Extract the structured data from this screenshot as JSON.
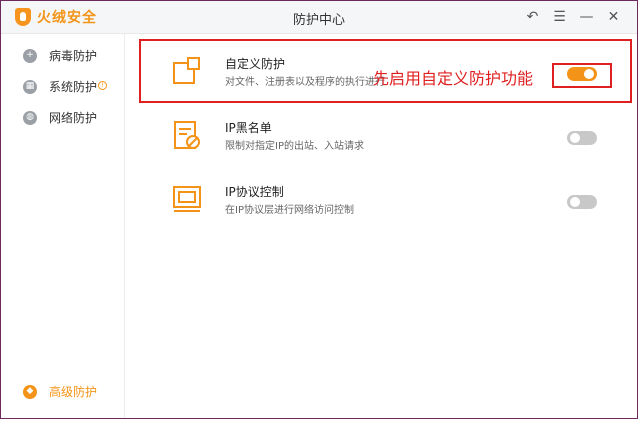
{
  "app": {
    "logo_text": "火绒安全",
    "window_title": "防护中心",
    "controls": {
      "back": "↶",
      "menu": "☰",
      "minimize": "—",
      "close": "✕"
    }
  },
  "sidebar": {
    "items": [
      {
        "label": "病毒防护",
        "icon": "virus-shield-icon"
      },
      {
        "label": "系统防护",
        "icon": "windows-icon",
        "badge": "!"
      },
      {
        "label": "网络防护",
        "icon": "globe-icon"
      }
    ],
    "bottom_item": {
      "label": "高级防护",
      "icon": "advanced-shield-icon"
    }
  },
  "rows": [
    {
      "title": "自定义防护",
      "desc": "对文件、注册表以及程序的执行进行",
      "toggle_on": true,
      "icon": "custom-protection-icon"
    },
    {
      "title": "IP黑名单",
      "desc": "限制对指定IP的出站、入站请求",
      "toggle_on": false,
      "icon": "ip-blacklist-icon"
    },
    {
      "title": "IP协议控制",
      "desc": "在IP协议层进行网络访问控制",
      "toggle_on": false,
      "icon": "ip-protocol-icon"
    }
  ],
  "annotation": {
    "text": "先启用自定义防护功能",
    "color": "#e02020"
  },
  "colors": {
    "accent": "#f39418",
    "toggle_off": "#c8c8c8"
  }
}
